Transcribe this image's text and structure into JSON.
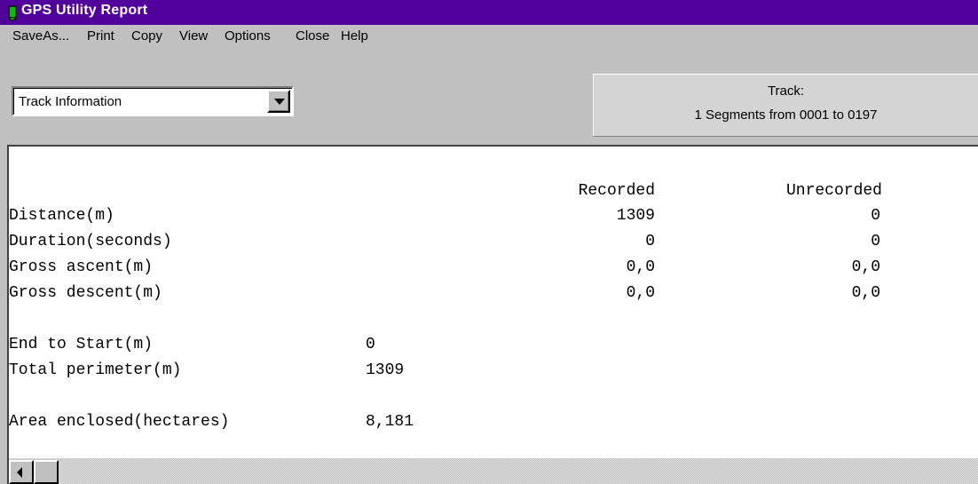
{
  "window": {
    "title": "GPS Utility Report",
    "title_bar_color": "#52009c",
    "app_icon": "gps-device-icon"
  },
  "menu": {
    "items": [
      "SaveAs...",
      "Print",
      "Copy",
      "View",
      "Options",
      "Close",
      "Help"
    ]
  },
  "toolbar": {
    "report_select": {
      "value": "Track Information",
      "icon": "chevron-down-icon"
    },
    "info_panel": {
      "line1": "Track:",
      "line2": "1 Segments from 0001 to 0197"
    }
  },
  "report": {
    "columns": {
      "recorded": "Recorded",
      "unrecorded": "Unrecorded"
    },
    "table_rows": [
      {
        "label": "Distance(m)",
        "recorded": "1309",
        "unrecorded": "0"
      },
      {
        "label": "Duration(seconds)",
        "recorded": "0",
        "unrecorded": "0"
      },
      {
        "label": "Gross ascent(m)",
        "recorded": "0,0",
        "unrecorded": "0,0"
      },
      {
        "label": "Gross descent(m)",
        "recorded": "0,0",
        "unrecorded": "0,0"
      }
    ],
    "summary": [
      {
        "label": "End to Start(m)",
        "value": "0"
      },
      {
        "label": "Total perimeter(m)",
        "value": "1309"
      },
      {
        "label": "Area enclosed(hectares)",
        "value": "8,181"
      }
    ]
  },
  "scrollbar": {
    "left_icon": "scroll-left-arrow-icon"
  }
}
